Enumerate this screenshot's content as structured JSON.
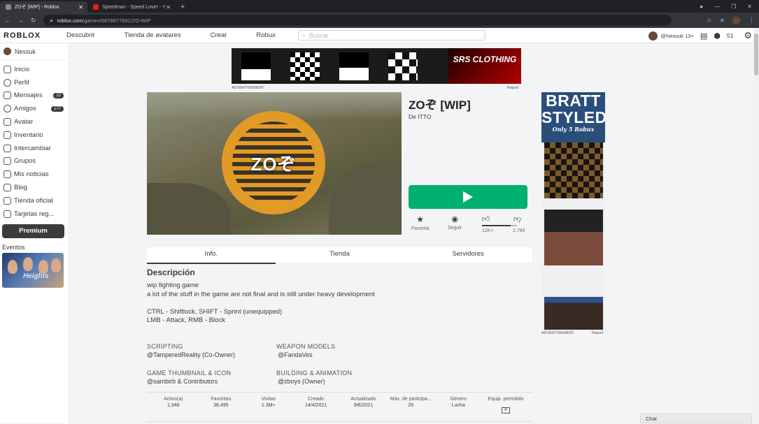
{
  "browser": {
    "tabs": [
      {
        "label": "ZOぞ [WIP] - Roblox",
        "active": true
      },
      {
        "label": "Speedman - Speed Lover - Y",
        "active": false
      }
    ],
    "url_host": "roblox.com",
    "url_path": "/games/6678877691/ZO-WIP"
  },
  "topnav": {
    "logo": "ROBLOX",
    "links": [
      "Descubrir",
      "Tienda de avatares",
      "Crear",
      "Robux"
    ],
    "search_placeholder": "Buscar",
    "username": "@Nessuk 13+",
    "robux": "51"
  },
  "sidebar": {
    "username": "Nessuk",
    "items": [
      {
        "label": "Inicio",
        "icon": "home-icon"
      },
      {
        "label": "Perfil",
        "icon": "profile-icon"
      },
      {
        "label": "Mensajes",
        "icon": "messages-icon",
        "badge": "22"
      },
      {
        "label": "Amigos",
        "icon": "friends-icon",
        "badge": "177"
      },
      {
        "label": "Avatar",
        "icon": "avatar-icon"
      },
      {
        "label": "Inventario",
        "icon": "inventory-icon"
      },
      {
        "label": "Intercambiar",
        "icon": "trade-icon"
      },
      {
        "label": "Grupos",
        "icon": "groups-icon"
      },
      {
        "label": "Mis noticias",
        "icon": "feed-icon"
      },
      {
        "label": "Blog",
        "icon": "blog-icon"
      },
      {
        "label": "Tienda oficial",
        "icon": "store-icon"
      },
      {
        "label": "Tarjetas reg...",
        "icon": "giftcard-icon"
      }
    ],
    "premium": "Premium",
    "events_label": "Eventos",
    "event_text": "Heights"
  },
  "ads": {
    "top_brand": "SRS CLOTHING",
    "label": "ADVERTISEMENT",
    "report": "Report",
    "side_title": "BRATT STYLED",
    "side_sub": "Only 5 Robux"
  },
  "game": {
    "thumb_text": "ZOぞ",
    "title": "ZOぞ [WIP]",
    "by": "De ITTO",
    "favorite": "Favorita",
    "follow": "Seguir",
    "upvotes": "12K+",
    "downvotes": "2,784",
    "upvote_ratio": 0.81
  },
  "tabs": [
    "Info.",
    "Tienda",
    "Servidores"
  ],
  "description": {
    "heading": "Descripción",
    "text": "wip fighting game\na lot of the stuff in the game are not final and is still under heavy development\n\nCTRL - Shiftlock, SHIFT - Sprint (unequipped)\nLMB - Attack, RMB - Block"
  },
  "credits": [
    {
      "title": "SCRIPTING",
      "name": "@TamperedReality (Co-Owner)"
    },
    {
      "title": "WEAPON MODELS",
      "name": "@FandaVes"
    },
    {
      "title": "GAME THUMBNAIL & ICON",
      "name": "@sambirb & Contributors"
    },
    {
      "title": "BUILDING & ANIMATION",
      "name": "@zboys (Owner)"
    }
  ],
  "stats": [
    {
      "label": "Activo(a)",
      "value": "1,946"
    },
    {
      "label": "Favoritas",
      "value": "38,495"
    },
    {
      "label": "Visitas",
      "value": "1.3M+"
    },
    {
      "label": "Creado",
      "value": "14/4/2021"
    },
    {
      "label": "Actualizado",
      "value": "9/6/2021"
    },
    {
      "label": "Máx. de participa...",
      "value": "25"
    },
    {
      "label": "Género",
      "value": "Lucha"
    },
    {
      "label": "Equip. permitido",
      "value": ""
    }
  ],
  "chat": "Chat",
  "colors": {
    "play": "#00b06f",
    "emblem": "#e29a26",
    "dark": "#393b3d"
  }
}
